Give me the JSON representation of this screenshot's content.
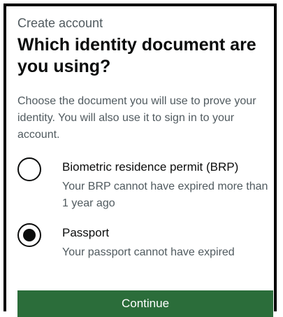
{
  "page": {
    "caption": "Create account",
    "heading": "Which identity document are you using?",
    "intro": "Choose the document you will use to prove your identity. You will also use it to sign in to your account."
  },
  "options": [
    {
      "label": "Biometric residence permit (BRP)",
      "hint": "Your BRP cannot have expired more than 1 year ago",
      "selected": false
    },
    {
      "label": "Passport",
      "hint": "Your passport cannot have expired",
      "selected": true
    }
  ],
  "actions": {
    "continue_label": "Continue"
  },
  "colors": {
    "button_green": "#2b6d3a",
    "text": "#0b0c0c",
    "secondary_text": "#505a5f"
  }
}
